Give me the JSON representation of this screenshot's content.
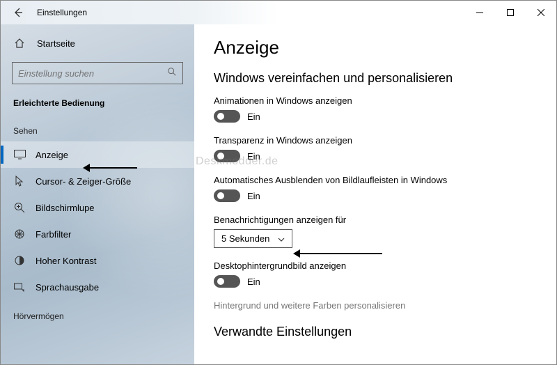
{
  "window": {
    "title": "Einstellungen"
  },
  "sidebar": {
    "home": "Startseite",
    "search_placeholder": "Einstellung suchen",
    "heading": "Erleichterte Bedienung",
    "group_sehen": "Sehen",
    "group_hoer": "Hörvermögen",
    "items": [
      {
        "label": "Anzeige"
      },
      {
        "label": "Cursor- & Zeiger-Größe"
      },
      {
        "label": "Bildschirmlupe"
      },
      {
        "label": "Farbfilter"
      },
      {
        "label": "Hoher Kontrast"
      },
      {
        "label": "Sprachausgabe"
      }
    ]
  },
  "main": {
    "page_title": "Anzeige",
    "group_title": "Windows vereinfachen und personalisieren",
    "settings": {
      "animations": {
        "label": "Animationen in Windows anzeigen",
        "state": "Ein"
      },
      "transparency": {
        "label": "Transparenz in Windows anzeigen",
        "state": "Ein"
      },
      "autohide": {
        "label": "Automatisches Ausblenden von Bildlaufleisten in Windows",
        "state": "Ein"
      },
      "notifications": {
        "label": "Benachrichtigungen anzeigen für",
        "value": "5 Sekunden"
      },
      "wallpaper": {
        "label": "Desktophintergrundbild anzeigen",
        "state": "Ein"
      }
    },
    "link": "Hintergrund und weitere Farben personalisieren",
    "related_title": "Verwandte Einstellungen"
  },
  "watermark": "Deskmodder.de"
}
